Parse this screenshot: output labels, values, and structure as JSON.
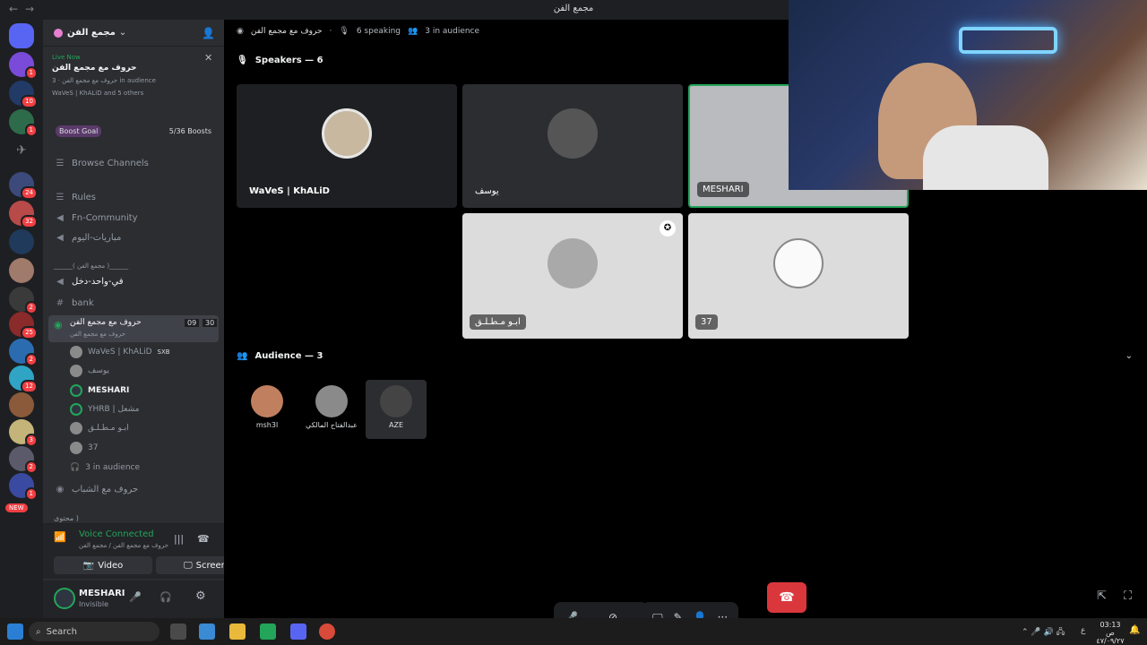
{
  "window": {
    "title": "مجمع الفن",
    "back": "←",
    "forward": "→"
  },
  "servers": {
    "badges": [
      "1",
      "10",
      "1",
      "24",
      "32",
      "2",
      "25",
      "2",
      "12",
      "3",
      "2",
      "1",
      "NEW"
    ]
  },
  "sidebar": {
    "server_name": "مجمع الفن",
    "live": {
      "tag": "Live Now",
      "title": "حروف مع مجمع الفن",
      "meta": "حروف مع مجمع الفن · 3 in audience",
      "people": "WaVeS | KhALiD and 5 others"
    },
    "boost": {
      "label": "Boost Goal",
      "count": "5/36 Boosts"
    },
    "browse": "Browse Channels",
    "channels": [
      {
        "icon": "☰",
        "name": "Rules"
      },
      {
        "icon": "◀",
        "name": "Fn-Community"
      },
      {
        "icon": "◀",
        "name": "مباريات-اليوم"
      },
      {
        "icon": "",
        "name": "______( مجمع الفن )______"
      },
      {
        "icon": "◀",
        "name": "في-واحد-دخل"
      },
      {
        "icon": "#",
        "name": "bank"
      }
    ],
    "active_stage": {
      "name": "حروف مع مجمع الفن",
      "sub": "حروف مع مجمع الفن",
      "n1": "09",
      "n2": "30"
    },
    "stage_users": [
      "WaVeS | KhALiD",
      "يوسف",
      "MESHARI",
      "YHRB | مشعل",
      "ابـو مـطـلـق",
      "37"
    ],
    "stage_user_tag": "SXB",
    "in_audience": "3 in audience",
    "more_channels": [
      "حروف مع الشباب",
      "محتوى )"
    ],
    "voice": {
      "status": "Voice Connected",
      "sub": "حروف مع مجمع الفن / مجمع الفن",
      "video": "Video",
      "screen": "Screen"
    },
    "user": {
      "name": "MESHARI",
      "status": "Invisible"
    }
  },
  "stage": {
    "header": {
      "title": "حروف مع مجمع الفن",
      "speaking": "6 speaking",
      "audience": "3 in audience"
    },
    "speakers_title": "Speakers — 6",
    "speakers": [
      "WaVeS | KhALiD",
      "يوسف",
      "MESHARI",
      "ابـو مـطـلـق",
      "37"
    ],
    "audience_title": "Audience — 3",
    "audience": [
      "msh3l",
      "عبدالفتاح المالكي",
      "AZE"
    ]
  },
  "controls": {
    "more": "···"
  },
  "taskbar": {
    "search": "Search",
    "time": "03:13 ص",
    "date": "٤٧/٠٩/٢٧",
    "lang": "ع"
  },
  "colors": {
    "accent": "#5865f2",
    "green": "#23a55a",
    "red": "#da373c"
  }
}
